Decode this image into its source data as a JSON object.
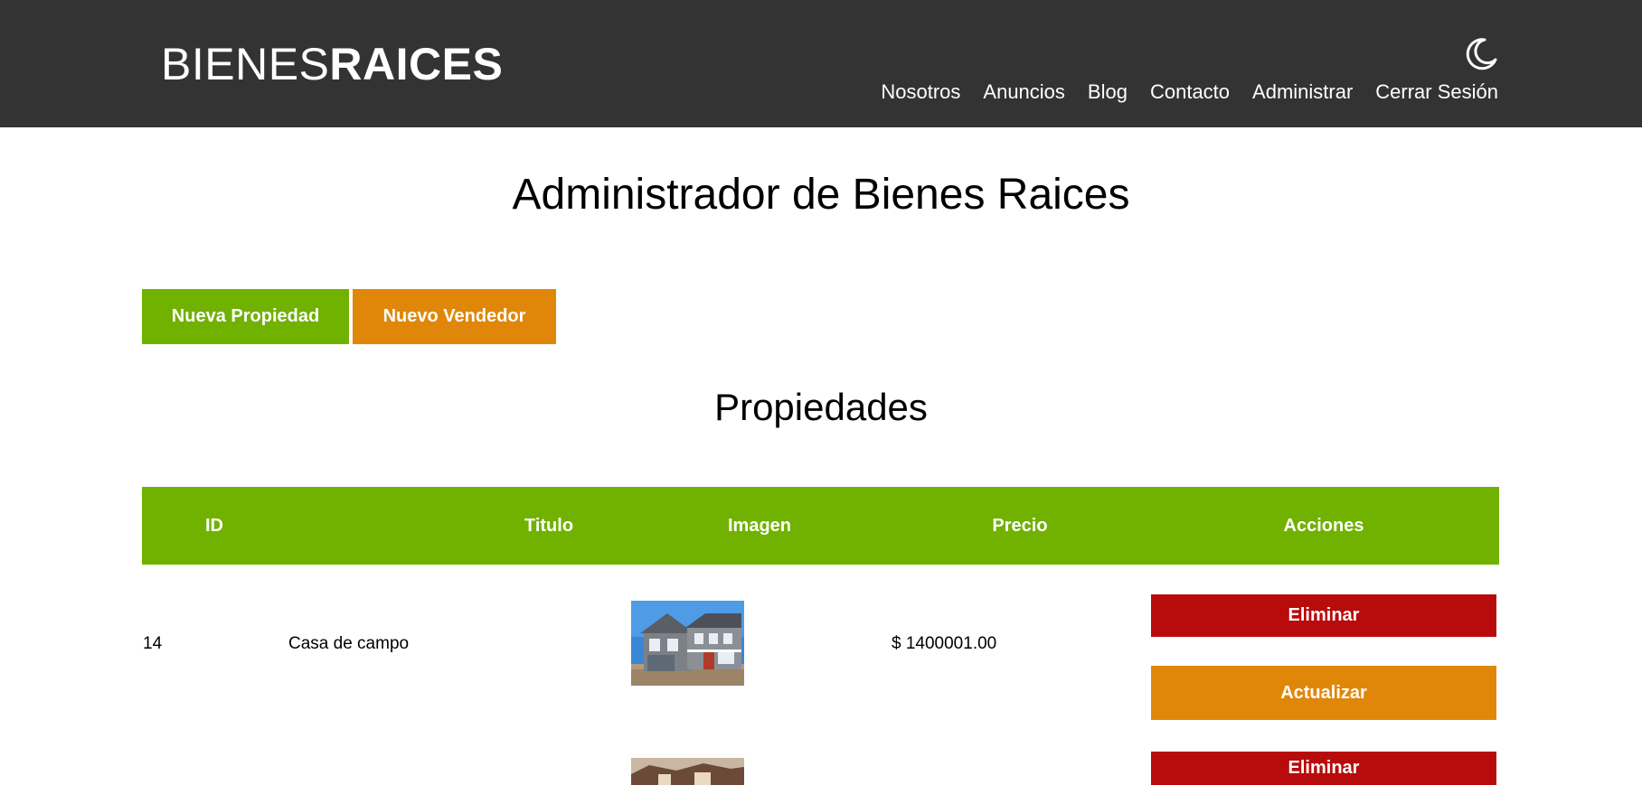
{
  "header": {
    "logo_thin": "BIENES",
    "logo_bold": "RAICES",
    "nav": [
      "Nosotros",
      "Anuncios",
      "Blog",
      "Contacto",
      "Administrar",
      "Cerrar Sesión"
    ],
    "theme_icon": "moon-icon"
  },
  "main": {
    "title": "Administrador de Bienes Raices",
    "new_property_label": "Nueva Propiedad",
    "new_seller_label": "Nuevo Vendedor",
    "section_title": "Propiedades"
  },
  "table": {
    "headers": [
      "ID",
      "Titulo",
      "Imagen",
      "Precio",
      "Acciones"
    ],
    "rows": [
      {
        "id": "14",
        "title": "Casa de campo",
        "price": "$ 1400001.00",
        "delete_label": "Eliminar",
        "update_label": "Actualizar"
      },
      {
        "delete_label": "Eliminar"
      }
    ]
  },
  "colors": {
    "header_bg": "#333333",
    "green": "#71b100",
    "orange": "#e08709",
    "red": "#b80b0b"
  }
}
